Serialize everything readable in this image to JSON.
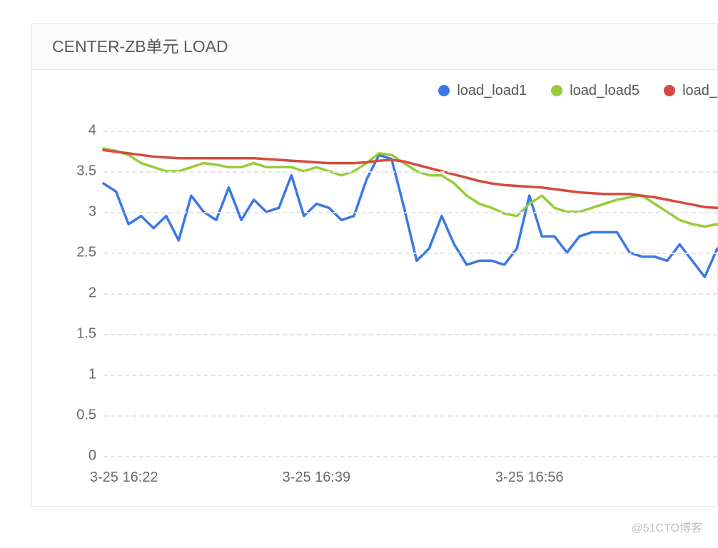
{
  "header": {
    "title": "CENTER-ZB单元 LOAD"
  },
  "legend": {
    "items": [
      {
        "label": "load_load1",
        "color": "#3a78e7"
      },
      {
        "label": "load_load5",
        "color": "#96cc39"
      },
      {
        "label": "load_",
        "color": "#d64a3d"
      }
    ]
  },
  "watermark": "@51CTO博客",
  "chart_data": {
    "type": "line",
    "title": "CENTER-ZB单元 LOAD",
    "xlabel": "",
    "ylabel": "",
    "ylim": [
      0,
      4
    ],
    "y_ticks": [
      0,
      0.5,
      1,
      1.5,
      2,
      2.5,
      3,
      3.5,
      4
    ],
    "x_ticks": [
      "3-25 16:22",
      "3-25 16:39",
      "3-25 16:56"
    ],
    "x": [
      0,
      1,
      2,
      3,
      4,
      5,
      6,
      7,
      8,
      9,
      10,
      11,
      12,
      13,
      14,
      15,
      16,
      17,
      18,
      19,
      20,
      21,
      22,
      23,
      24,
      25,
      26,
      27,
      28,
      29,
      30,
      31,
      32,
      33,
      34,
      35,
      36,
      37,
      38,
      39,
      40,
      41,
      42,
      43,
      44,
      45,
      46,
      47,
      48,
      49
    ],
    "series": [
      {
        "name": "load_load1",
        "color": "#3a78e7",
        "values": [
          3.35,
          3.25,
          2.85,
          2.95,
          2.8,
          2.95,
          2.65,
          3.2,
          3.0,
          2.9,
          3.3,
          2.9,
          3.15,
          3.0,
          3.05,
          3.45,
          2.95,
          3.1,
          3.05,
          2.9,
          2.95,
          3.4,
          3.7,
          3.65,
          3.05,
          2.4,
          2.55,
          2.95,
          2.6,
          2.35,
          2.4,
          2.4,
          2.35,
          2.55,
          3.2,
          2.7,
          2.7,
          2.5,
          2.7,
          2.75,
          2.75,
          2.75,
          2.5,
          2.45,
          2.45,
          2.4,
          2.6,
          2.4,
          2.2,
          2.55
        ]
      },
      {
        "name": "load_load5",
        "color": "#96cc39",
        "values": [
          3.78,
          3.75,
          3.7,
          3.6,
          3.55,
          3.5,
          3.5,
          3.55,
          3.6,
          3.58,
          3.55,
          3.55,
          3.6,
          3.55,
          3.55,
          3.55,
          3.5,
          3.55,
          3.5,
          3.45,
          3.5,
          3.6,
          3.72,
          3.7,
          3.6,
          3.5,
          3.45,
          3.45,
          3.35,
          3.2,
          3.1,
          3.05,
          2.98,
          2.95,
          3.1,
          3.2,
          3.05,
          3.0,
          3.0,
          3.05,
          3.1,
          3.15,
          3.18,
          3.2,
          3.1,
          3.0,
          2.9,
          2.85,
          2.82,
          2.85
        ]
      },
      {
        "name": "load_",
        "color": "#d64a3d",
        "values": [
          3.76,
          3.74,
          3.72,
          3.7,
          3.68,
          3.67,
          3.66,
          3.66,
          3.66,
          3.66,
          3.66,
          3.66,
          3.66,
          3.65,
          3.64,
          3.63,
          3.62,
          3.61,
          3.6,
          3.6,
          3.6,
          3.61,
          3.63,
          3.64,
          3.62,
          3.58,
          3.54,
          3.5,
          3.46,
          3.42,
          3.38,
          3.35,
          3.33,
          3.32,
          3.31,
          3.3,
          3.28,
          3.26,
          3.24,
          3.23,
          3.22,
          3.22,
          3.22,
          3.2,
          3.18,
          3.15,
          3.12,
          3.09,
          3.06,
          3.05
        ]
      }
    ]
  }
}
